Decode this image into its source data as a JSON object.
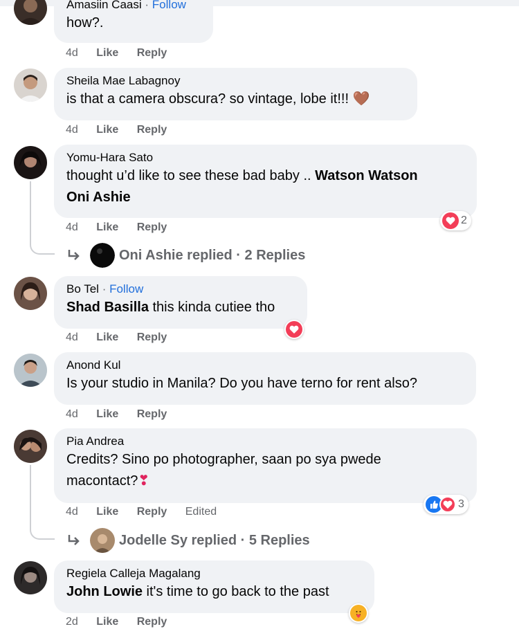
{
  "comments": [
    {
      "author": "Amasiin Caasi",
      "follow": "Follow",
      "text": "how?.",
      "time": "4d",
      "like": "Like",
      "reply": "Reply"
    },
    {
      "author": "Sheila Mae Labagnoy",
      "text": "is that a camera obscura? so vintage, lobe it!!! 🤎",
      "time": "4d",
      "like": "Like",
      "reply": "Reply"
    },
    {
      "author": "Yomu-Hara Sato",
      "text_pre": "thought u’d like to see these bad baby .. ",
      "mention1": "Watson Watson",
      "mention2": "Oni Ashie",
      "time": "4d",
      "like": "Like",
      "reply": "Reply",
      "reaction_count": "2",
      "replies_label": "Oni Ashie replied · 2 Replies"
    },
    {
      "author": "Bo Tel",
      "follow": "Follow",
      "mention": "Shad Basilla",
      "text_post": " this kinda cutiee tho",
      "time": "4d",
      "like": "Like",
      "reply": "Reply"
    },
    {
      "author": "Anond Kul",
      "text": "Is your studio in Manila? Do you have terno for rent also?",
      "time": "4d",
      "like": "Like",
      "reply": "Reply"
    },
    {
      "author": "Pia Andrea",
      "text_line1": "Credits? Sino po photographer, saan po sya pwede",
      "text_line2": "macontact?",
      "emoji": "❣",
      "time": "4d",
      "like": "Like",
      "reply": "Reply",
      "edited": "Edited",
      "reaction_count": "3",
      "replies_label": "Jodelle Sy replied · 5 Replies"
    },
    {
      "author": "Regiela Calleja Magalang",
      "mention": "John Lowie",
      "text_post": " it's time to go back to the past",
      "time": "2d",
      "like": "Like",
      "reply": "Reply"
    }
  ],
  "colors": {
    "bubble": "#f0f2f5",
    "link_blue": "#216fdb",
    "meta_gray": "#65676b",
    "heart_red": "#f33e58",
    "like_blue": "#1877f2"
  }
}
